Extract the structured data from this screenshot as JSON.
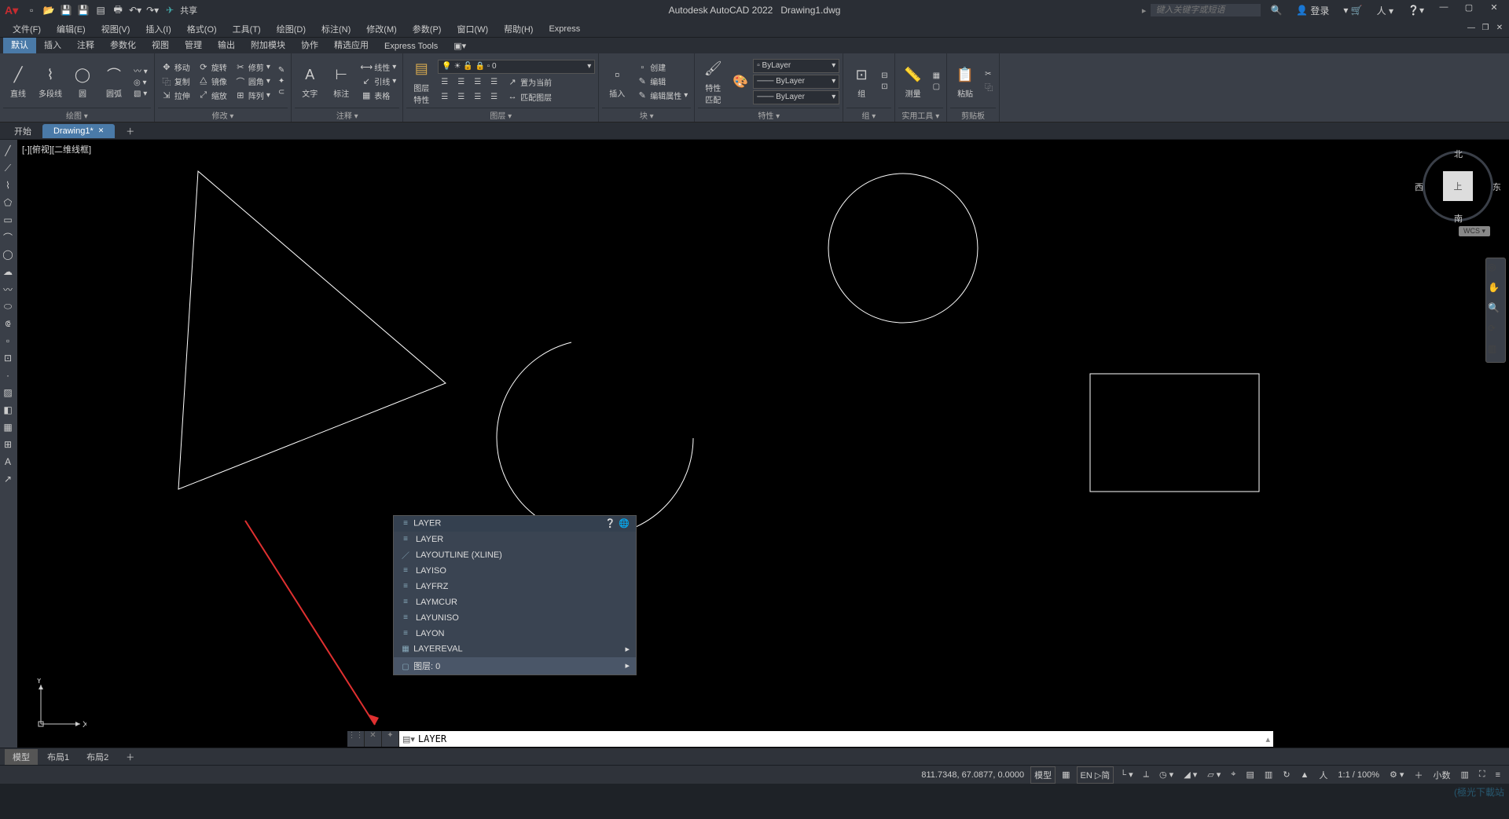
{
  "app": {
    "title": "Autodesk AutoCAD 2022",
    "doc": "Drawing1.dwg"
  },
  "qat": {
    "share": "共享"
  },
  "search": {
    "placeholder": "键入关键字或短语"
  },
  "titlebar_right": {
    "login": "登录"
  },
  "menubar": [
    "文件(F)",
    "编辑(E)",
    "视图(V)",
    "插入(I)",
    "格式(O)",
    "工具(T)",
    "绘图(D)",
    "标注(N)",
    "修改(M)",
    "参数(P)",
    "窗口(W)",
    "帮助(H)",
    "Express"
  ],
  "ribbon_tabs": [
    "默认",
    "插入",
    "注释",
    "参数化",
    "视图",
    "管理",
    "输出",
    "附加模块",
    "协作",
    "精选应用",
    "Express Tools"
  ],
  "ribbon": {
    "draw": {
      "line": "直线",
      "polyline": "多段线",
      "circle": "圆",
      "arc": "圆弧",
      "title": "绘图 ▾"
    },
    "modify": {
      "move": "移动",
      "rotate": "旋转",
      "trim": "修剪",
      "copy": "复制",
      "mirror": "镜像",
      "fillet": "圆角",
      "stretch": "拉伸",
      "scale": "缩放",
      "array": "阵列",
      "title": "修改 ▾"
    },
    "annot": {
      "text": "文字",
      "dim": "标注",
      "linetype": "线性",
      "leader": "引线",
      "table": "表格",
      "title": "注释 ▾"
    },
    "layers": {
      "props": "图层\n特性",
      "current": "0",
      "setcur": "置为当前",
      "match": "匹配图层",
      "title": "图层 ▾"
    },
    "block": {
      "insert": "插入",
      "create": "创建",
      "edit": "编辑",
      "attr": "编辑属性",
      "title": "块 ▾"
    },
    "props": {
      "match": "特性\n匹配",
      "bylayer": "ByLayer",
      "title": "特性 ▾"
    },
    "group": {
      "group": "组",
      "title": "组 ▾"
    },
    "util": {
      "measure": "测量",
      "title": "实用工具 ▾"
    },
    "clip": {
      "paste": "粘贴",
      "title": "剪贴板"
    }
  },
  "doctabs": {
    "start": "开始",
    "drawing": "Drawing1*"
  },
  "viewport": {
    "label": "[-][俯视][二维线框]"
  },
  "viewcube": {
    "top": "上",
    "n": "北",
    "s": "南",
    "e": "东",
    "w": "西",
    "wcs": "WCS ▾"
  },
  "ucs": {
    "x": "X",
    "y": "Y"
  },
  "autocomplete": {
    "header": "LAYER",
    "items": [
      {
        "icon": "≡",
        "text": "LAYER"
      },
      {
        "icon": "／",
        "text": "LAYOUTLINE (XLINE)"
      },
      {
        "icon": "≡",
        "text": "LAYISO"
      },
      {
        "icon": "≡",
        "text": "LAYFRZ"
      },
      {
        "icon": "≡",
        "text": "LAYMCUR"
      },
      {
        "icon": "≡",
        "text": "LAYUNISO"
      },
      {
        "icon": "≡",
        "text": "LAYON"
      },
      {
        "icon": "▦",
        "text": "LAYEREVAL"
      },
      {
        "icon": "▢",
        "text": "图层: 0"
      }
    ]
  },
  "cmdline": {
    "value": "LAYER"
  },
  "layouttabs": {
    "model": "模型",
    "l1": "布局1",
    "l2": "布局2"
  },
  "status": {
    "coords": "811.7348, 67.0877, 0.0000",
    "space": "模型",
    "grid": "▦",
    "ime": "EN ▷简",
    "scale": "1:1 / 100%",
    "dec": "小数"
  },
  "watermark": "(極光下載站"
}
